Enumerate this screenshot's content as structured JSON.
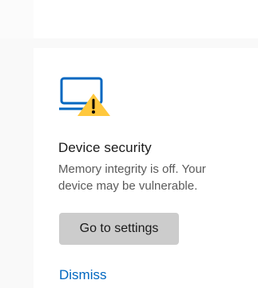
{
  "security_card": {
    "title": "Device security",
    "description": "Memory integrity is off. Your device may be vulnerable.",
    "icon": "laptop-warning-icon",
    "primary_action_label": "Go to settings",
    "secondary_action_label": "Dismiss"
  },
  "colors": {
    "accent": "#0067c0",
    "warning": "#ffc83d",
    "button_background": "#cccccc",
    "card_background": "#ffffff",
    "page_background": "#f9f9f9"
  }
}
